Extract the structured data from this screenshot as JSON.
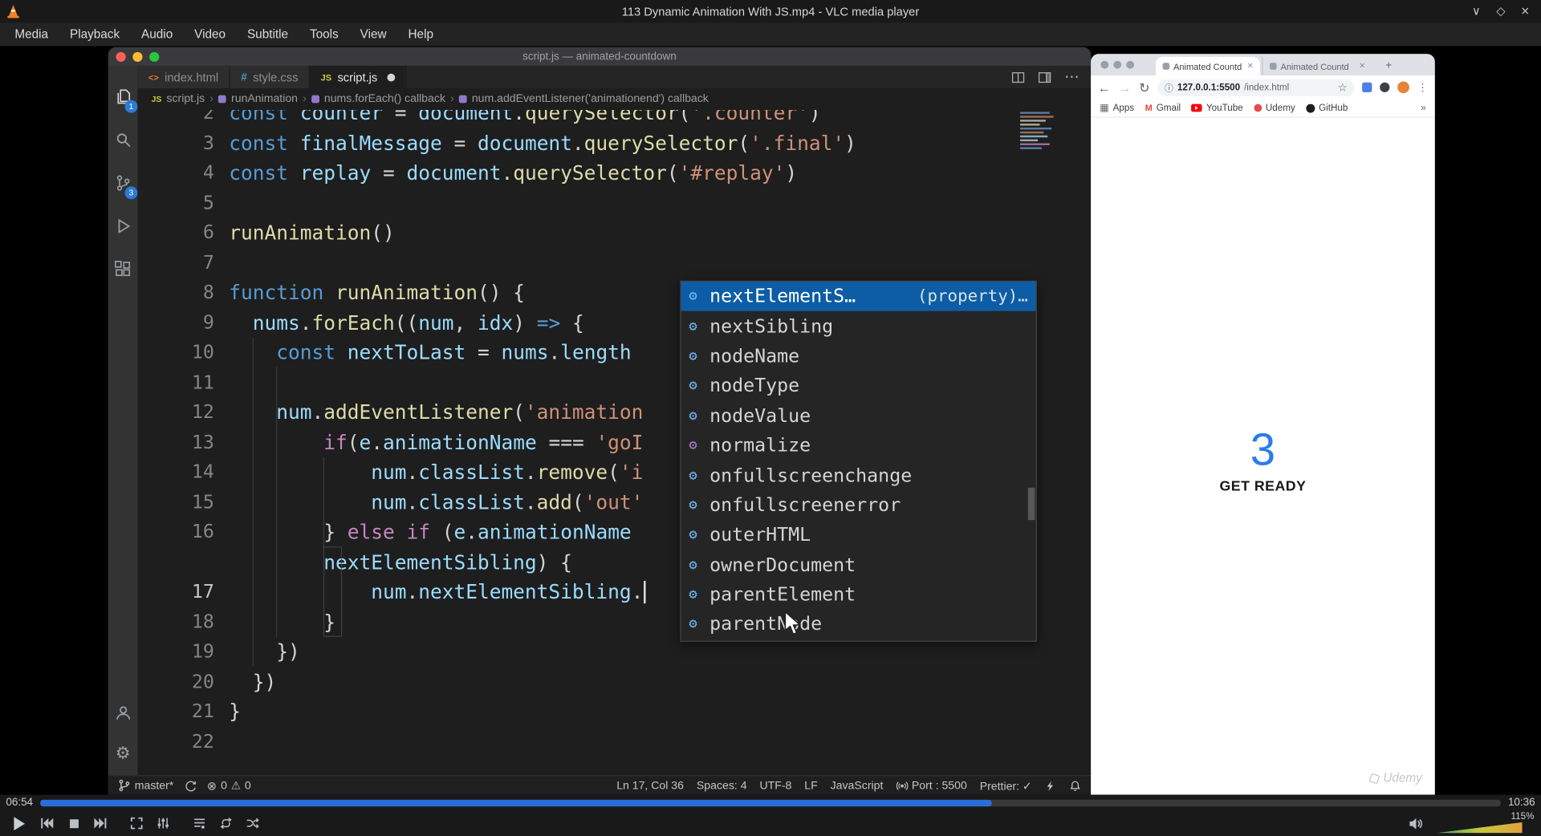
{
  "vlc": {
    "window_title": "113 Dynamic Animation With JS.mp4 - VLC media player",
    "menu": [
      "Media",
      "Playback",
      "Audio",
      "Video",
      "Subtitle",
      "Tools",
      "View",
      "Help"
    ],
    "time_elapsed": "06:54",
    "time_total": "10:36",
    "progress_pct": 65.1,
    "volume_label": "115%"
  },
  "vscode": {
    "window_title": "script.js — animated-countdown",
    "activity": {
      "explorer_badge": "1",
      "scm_badge": "3"
    },
    "tabs": [
      {
        "label": "index.html",
        "icon": "<>"
      },
      {
        "label": "style.css",
        "icon": "#"
      },
      {
        "label": "script.js",
        "icon": "JS"
      }
    ],
    "breadcrumb": [
      "script.js",
      "runAnimation",
      "nums.forEach() callback",
      "num.addEventListener('animationend') callback"
    ],
    "editor": {
      "lines": [
        {
          "n": "2",
          "t": [
            [
              "k",
              "const"
            ],
            [
              "p",
              " "
            ],
            [
              "v",
              "counter"
            ],
            [
              "p",
              " = "
            ],
            [
              "v",
              "document"
            ],
            [
              "p",
              "."
            ],
            [
              "f",
              "querySelector"
            ],
            [
              "p",
              "("
            ],
            [
              "s",
              "'.counter'"
            ],
            [
              "p",
              ")"
            ]
          ]
        },
        {
          "n": "3",
          "t": [
            [
              "k",
              "const"
            ],
            [
              "p",
              " "
            ],
            [
              "v",
              "finalMessage"
            ],
            [
              "p",
              " = "
            ],
            [
              "v",
              "document"
            ],
            [
              "p",
              "."
            ],
            [
              "f",
              "querySelector"
            ],
            [
              "p",
              "("
            ],
            [
              "s",
              "'.final'"
            ],
            [
              "p",
              ")"
            ]
          ]
        },
        {
          "n": "4",
          "t": [
            [
              "k",
              "const"
            ],
            [
              "p",
              " "
            ],
            [
              "v",
              "replay"
            ],
            [
              "p",
              " = "
            ],
            [
              "v",
              "document"
            ],
            [
              "p",
              "."
            ],
            [
              "f",
              "querySelector"
            ],
            [
              "p",
              "("
            ],
            [
              "s",
              "'#replay'"
            ],
            [
              "p",
              ")"
            ]
          ]
        },
        {
          "n": "5",
          "t": []
        },
        {
          "n": "6",
          "t": [
            [
              "f",
              "runAnimation"
            ],
            [
              "p",
              "()"
            ]
          ]
        },
        {
          "n": "7",
          "t": []
        },
        {
          "n": "8",
          "t": [
            [
              "k",
              "function"
            ],
            [
              "p",
              " "
            ],
            [
              "f",
              "runAnimation"
            ],
            [
              "p",
              "() {"
            ]
          ]
        },
        {
          "n": "9",
          "t": [
            [
              "p",
              "  "
            ],
            [
              "v",
              "nums"
            ],
            [
              "p",
              "."
            ],
            [
              "f",
              "forEach"
            ],
            [
              "p",
              "(("
            ],
            [
              "v",
              "num"
            ],
            [
              "p",
              ", "
            ],
            [
              "v",
              "idx"
            ],
            [
              "p",
              ") "
            ],
            [
              "k",
              "=>"
            ],
            [
              "p",
              " {"
            ]
          ]
        },
        {
          "n": "10",
          "t": [
            [
              "p",
              "    "
            ],
            [
              "k",
              "const"
            ],
            [
              "p",
              " "
            ],
            [
              "v",
              "nextToLast"
            ],
            [
              "p",
              " = "
            ],
            [
              "v",
              "nums"
            ],
            [
              "p",
              "."
            ],
            [
              "v",
              "length"
            ]
          ]
        },
        {
          "n": "11",
          "t": []
        },
        {
          "n": "12",
          "t": [
            [
              "p",
              "    "
            ],
            [
              "v",
              "num"
            ],
            [
              "p",
              "."
            ],
            [
              "f",
              "addEventListener"
            ],
            [
              "p",
              "("
            ],
            [
              "s",
              "'animation"
            ]
          ]
        },
        {
          "n": "13",
          "t": [
            [
              "p",
              "        "
            ],
            [
              "c",
              "if"
            ],
            [
              "p",
              "("
            ],
            [
              "v",
              "e"
            ],
            [
              "p",
              "."
            ],
            [
              "v",
              "animationName"
            ],
            [
              "p",
              " === "
            ],
            [
              "s",
              "'goI"
            ]
          ]
        },
        {
          "n": "14",
          "t": [
            [
              "p",
              "            "
            ],
            [
              "v",
              "num"
            ],
            [
              "p",
              "."
            ],
            [
              "v",
              "classList"
            ],
            [
              "p",
              "."
            ],
            [
              "f",
              "remove"
            ],
            [
              "p",
              "("
            ],
            [
              "s",
              "'i"
            ]
          ]
        },
        {
          "n": "15",
          "t": [
            [
              "p",
              "            "
            ],
            [
              "v",
              "num"
            ],
            [
              "p",
              "."
            ],
            [
              "v",
              "classList"
            ],
            [
              "p",
              "."
            ],
            [
              "f",
              "add"
            ],
            [
              "p",
              "("
            ],
            [
              "s",
              "'out'"
            ]
          ]
        },
        {
          "n": "16",
          "t": [
            [
              "p",
              "        } "
            ],
            [
              "c",
              "else"
            ],
            [
              "p",
              " "
            ],
            [
              "c",
              "if"
            ],
            [
              "p",
              " ("
            ],
            [
              "v",
              "e"
            ],
            [
              "p",
              "."
            ],
            [
              "v",
              "animationName"
            ]
          ]
        },
        {
          "n": "",
          "t": [
            [
              "p",
              "        "
            ],
            [
              "v",
              "nextElementSibling"
            ],
            [
              "p",
              ") {"
            ]
          ]
        },
        {
          "n": "17",
          "t": [
            [
              "p",
              "            "
            ],
            [
              "v",
              "num"
            ],
            [
              "p",
              "."
            ],
            [
              "v",
              "nextElementSibling"
            ],
            [
              "p",
              "."
            ]
          ],
          "cursor": true
        },
        {
          "n": "18",
          "t": [
            [
              "p",
              "        }"
            ]
          ]
        },
        {
          "n": "19",
          "t": [
            [
              "p",
              "    })"
            ]
          ]
        },
        {
          "n": "20",
          "t": [
            [
              "p",
              "  })"
            ]
          ]
        },
        {
          "n": "21",
          "t": [
            [
              "p",
              "}"
            ]
          ]
        },
        {
          "n": "22",
          "t": []
        }
      ]
    },
    "suggest": {
      "items": [
        {
          "label": "nextElementS…",
          "detail": "(property)…",
          "kind": "property",
          "selected": true
        },
        {
          "label": "nextSibling",
          "kind": "property"
        },
        {
          "label": "nodeName",
          "kind": "property"
        },
        {
          "label": "nodeType",
          "kind": "property"
        },
        {
          "label": "nodeValue",
          "kind": "property"
        },
        {
          "label": "normalize",
          "kind": "method"
        },
        {
          "label": "onfullscreenchange",
          "kind": "property"
        },
        {
          "label": "onfullscreenerror",
          "kind": "property"
        },
        {
          "label": "outerHTML",
          "kind": "property"
        },
        {
          "label": "ownerDocument",
          "kind": "property"
        },
        {
          "label": "parentElement",
          "kind": "property"
        },
        {
          "label": "parentNode",
          "kind": "property"
        }
      ]
    },
    "status": {
      "branch": "master*",
      "errors": "0",
      "warnings": "0",
      "ln_col": "Ln 17, Col 36",
      "spaces": "Spaces: 4",
      "encoding": "UTF-8",
      "eol": "LF",
      "language": "JavaScript",
      "port": "Port : 5500",
      "prettier": "Prettier: ✓"
    }
  },
  "chrome": {
    "tabs": [
      {
        "label": "Animated Countd"
      },
      {
        "label": "Animated Countd"
      }
    ],
    "url_host": "127.0.0.1:5500",
    "url_path": "/index.html",
    "bookmarks": [
      "Apps",
      "Gmail",
      "YouTube",
      "Udemy",
      "GitHub"
    ],
    "page": {
      "counter": "3",
      "message": "GET READY",
      "watermark": "Udemy"
    }
  }
}
